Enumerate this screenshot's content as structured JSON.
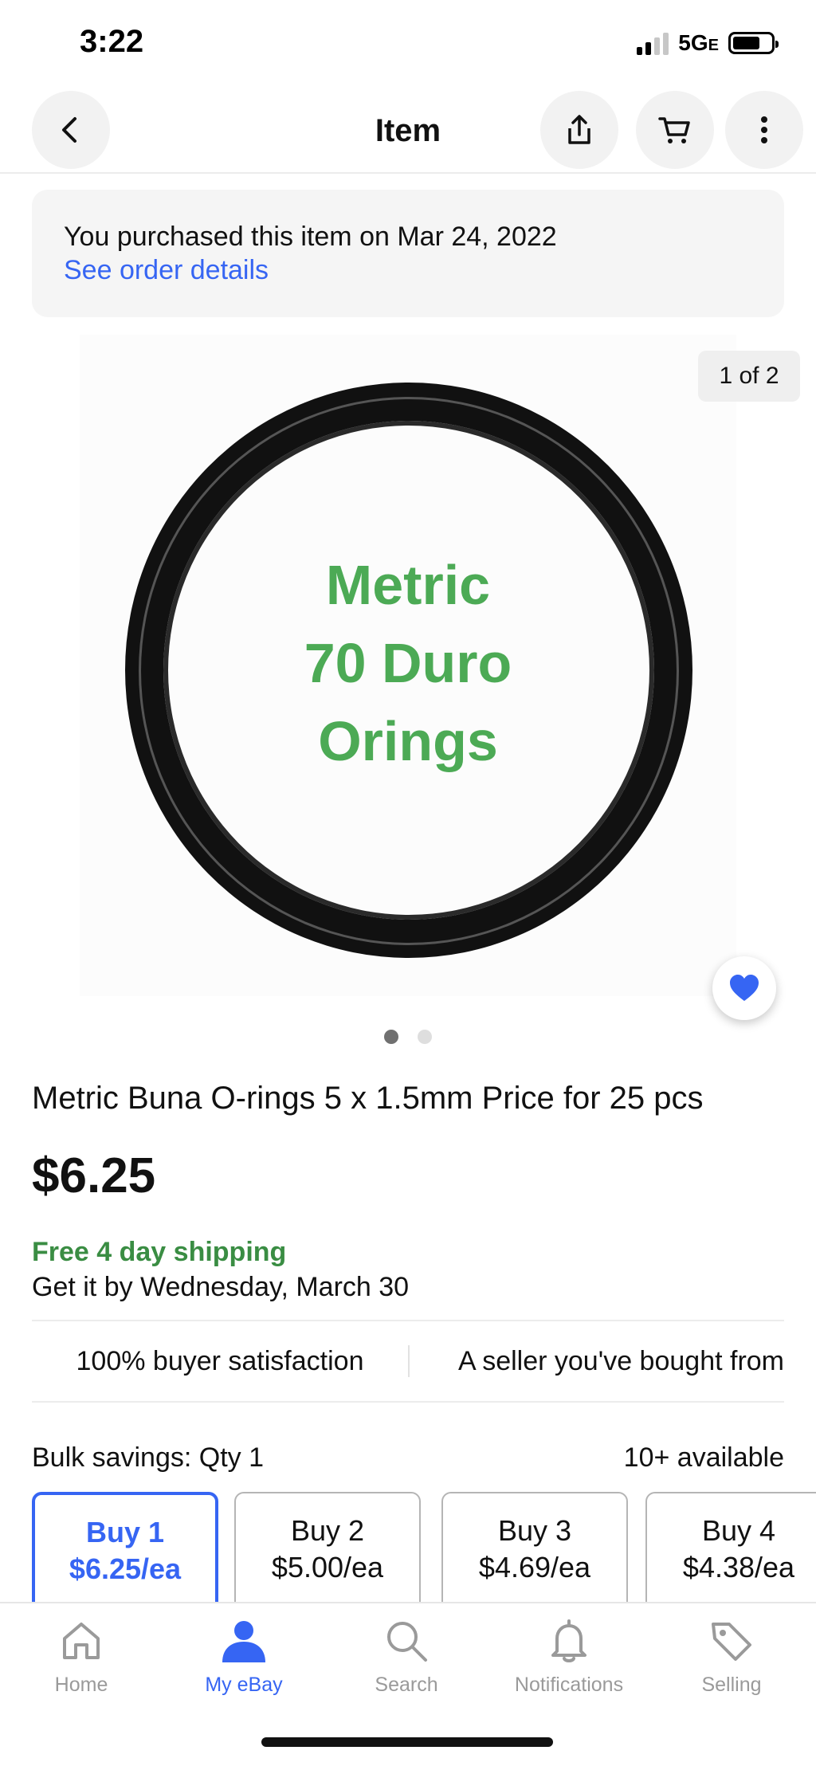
{
  "status_bar": {
    "time": "3:22",
    "network": "5G",
    "network_suffix": "E"
  },
  "header": {
    "title": "Item"
  },
  "purchase": {
    "text": "You purchased this item on Mar 24, 2022",
    "link": "See order details"
  },
  "image": {
    "lines": [
      "Metric",
      "70 Duro",
      "Orings"
    ],
    "counter": "1 of 2",
    "active_index": 1,
    "total": 2
  },
  "item": {
    "title": "Metric Buna  O-rings 5 x 1.5mm  Price for 25 pcs",
    "price": "$6.25",
    "shipping": "Free 4 day shipping",
    "delivery": "Get it by Wednesday, March 30"
  },
  "seller": {
    "satisfaction": "100% buyer satisfaction",
    "relation": "A seller you've bought from"
  },
  "bulk": {
    "label": "Bulk savings: Qty 1",
    "available": "10+ available",
    "tiers": [
      {
        "qty": "Buy 1",
        "price": "$6.25/ea",
        "selected": true
      },
      {
        "qty": "Buy 2",
        "price": "$5.00/ea",
        "selected": false
      },
      {
        "qty": "Buy 3",
        "price": "$4.69/ea",
        "selected": false
      },
      {
        "qty": "Buy 4",
        "price": "$4.38/ea",
        "selected": false
      }
    ]
  },
  "tabbar": {
    "items": [
      {
        "label": "Home",
        "icon": "home-icon",
        "active": false
      },
      {
        "label": "My eBay",
        "icon": "person-icon",
        "active": true
      },
      {
        "label": "Search",
        "icon": "search-icon",
        "active": false
      },
      {
        "label": "Notifications",
        "icon": "bell-icon",
        "active": false
      },
      {
        "label": "Selling",
        "icon": "tag-icon",
        "active": false
      }
    ]
  },
  "colors": {
    "accent": "#3665f3",
    "shipping_green": "#3a8d43",
    "image_text_green": "#4caa55"
  }
}
